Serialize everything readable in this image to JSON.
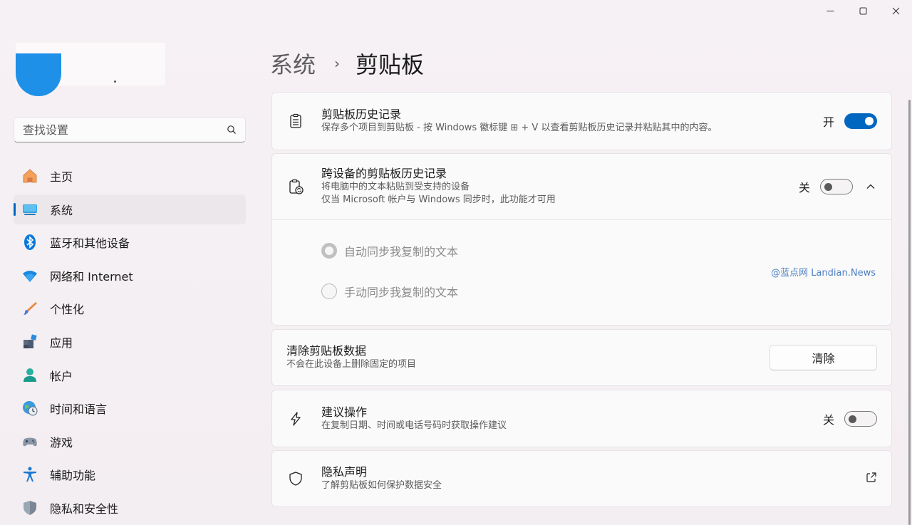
{
  "window": {
    "minimize_icon": "minimize-icon",
    "maximize_icon": "maximize-icon",
    "close_icon": "close-icon"
  },
  "search": {
    "placeholder": "查找设置"
  },
  "sidebar": {
    "items": [
      {
        "label": "主页",
        "icon": "home-icon"
      },
      {
        "label": "系统",
        "icon": "monitor-icon",
        "active": true
      },
      {
        "label": "蓝牙和其他设备",
        "icon": "bluetooth-icon"
      },
      {
        "label": "网络和 Internet",
        "icon": "wifi-icon"
      },
      {
        "label": "个性化",
        "icon": "brush-icon"
      },
      {
        "label": "应用",
        "icon": "apps-icon"
      },
      {
        "label": "帐户",
        "icon": "account-icon"
      },
      {
        "label": "时间和语言",
        "icon": "globe-clock-icon"
      },
      {
        "label": "游戏",
        "icon": "gamepad-icon"
      },
      {
        "label": "辅助功能",
        "icon": "accessibility-icon"
      },
      {
        "label": "隐私和安全性",
        "icon": "shield-icon"
      }
    ]
  },
  "breadcrumb": {
    "parent": "系统",
    "separator": "›",
    "current": "剪贴板"
  },
  "clipboard_history": {
    "title": "剪贴板历史记录",
    "subtitle": "保存多个项目到剪贴板 - 按 Windows 徽标键 ⊞ + V 以查看剪贴板历史记录并粘贴其中的内容。",
    "state_label": "开"
  },
  "cross_device": {
    "title": "跨设备的剪贴板历史记录",
    "subtitle1": "将电脑中的文本粘贴到受支持的设备",
    "subtitle2": "仅当 Microsoft 帐户与 Windows 同步时，此功能才可用",
    "state_label": "关",
    "option_auto": "自动同步我复制的文本",
    "option_manual": "手动同步我复制的文本",
    "watermark": "@蓝点网 Landian.News"
  },
  "clear_data": {
    "title": "清除剪贴板数据",
    "subtitle": "不会在此设备上删除固定的项目",
    "button": "清除"
  },
  "suggested_actions": {
    "title": "建议操作",
    "subtitle": "在复制日期、时间或电话号码时获取操作建议",
    "state_label": "关"
  },
  "privacy": {
    "title": "隐私声明",
    "subtitle": "了解剪贴板如何保护数据安全"
  },
  "colors": {
    "accent": "#0067c0"
  }
}
